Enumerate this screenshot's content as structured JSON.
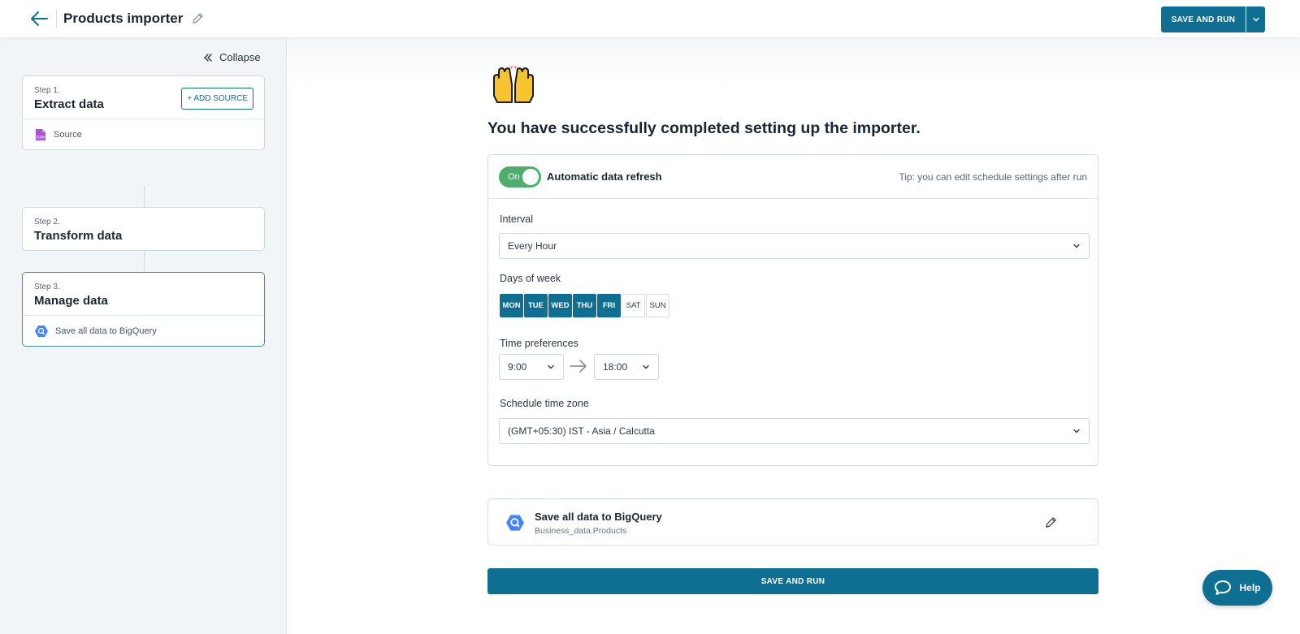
{
  "header": {
    "title": "Products importer",
    "save_label": "SAVE AND RUN"
  },
  "sidebar": {
    "collapse_label": "Collapse",
    "steps": [
      {
        "num": "Step 1.",
        "title": "Extract data",
        "item": "Source",
        "action": "+ ADD SOURCE"
      },
      {
        "num": "Step 2.",
        "title": "Transform data"
      },
      {
        "num": "Step 3.",
        "title": "Manage data",
        "item": "Save all data to BigQuery"
      }
    ]
  },
  "main": {
    "success_title": "You have successfully completed setting up the importer.",
    "schedule": {
      "toggle_label": "On",
      "toggle_on": true,
      "auto_label": "Automatic data refresh",
      "tip": "Tip: you can edit schedule settings after run",
      "interval_label": "Interval",
      "interval_value": "Every Hour",
      "days_label": "Days of week",
      "days": [
        {
          "label": "MON",
          "selected": true
        },
        {
          "label": "TUE",
          "selected": true
        },
        {
          "label": "WED",
          "selected": true
        },
        {
          "label": "THU",
          "selected": true
        },
        {
          "label": "FRI",
          "selected": true
        },
        {
          "label": "SAT",
          "selected": false
        },
        {
          "label": "SUN",
          "selected": false
        }
      ],
      "time_label": "Time preferences",
      "time_from": "9:00",
      "time_to": "18:00",
      "tz_label": "Schedule time zone",
      "tz_value": "(GMT+05:30) IST - Asia / Calcutta"
    },
    "destination": {
      "title": "Save all data to BigQuery",
      "subtitle": "Business_data.Products"
    },
    "save_label": "SAVE AND RUN",
    "help_label": "Help"
  },
  "colors": {
    "primary": "#0e6f93",
    "toggle_on": "#4caf6e",
    "bigquery": "#4285f4",
    "json_icon": "#a855d8"
  }
}
